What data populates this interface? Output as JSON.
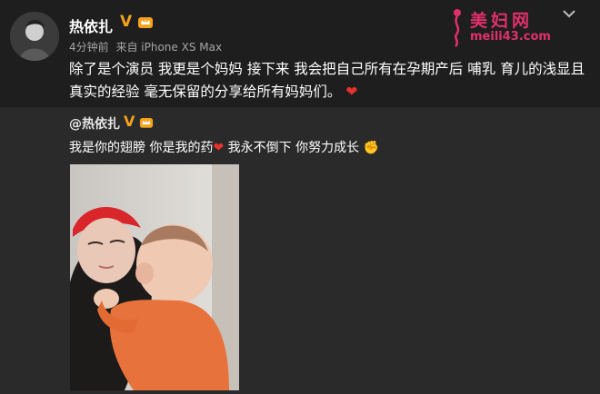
{
  "post": {
    "username": "热依扎",
    "verified_icon": "verified-v-icon",
    "member_icon": "member-crown-icon",
    "time": "4分钟前",
    "source": "来自 iPhone XS Max",
    "text": "除了是个演员 我更是个妈妈 接下来 我会把自己所有在孕期产后 哺乳 育儿的浅显且真实的经验 毫无保留的分享给所有妈妈们。",
    "emoji": "❤"
  },
  "watermark": {
    "title": "美妇网",
    "url": "meili43.com"
  },
  "repost": {
    "username": "@热依扎",
    "text_part1": "我是你的翅膀 你是我的药",
    "heart": "❤",
    "text_part2": " 我永不倒下 你努力成长",
    "fist": "✊"
  },
  "colors": {
    "background": "#1e1e1e",
    "repost_background": "#2a2a2a",
    "verified": "#f6a21b",
    "heart": "#e8312f",
    "watermark": "#e0306c"
  }
}
